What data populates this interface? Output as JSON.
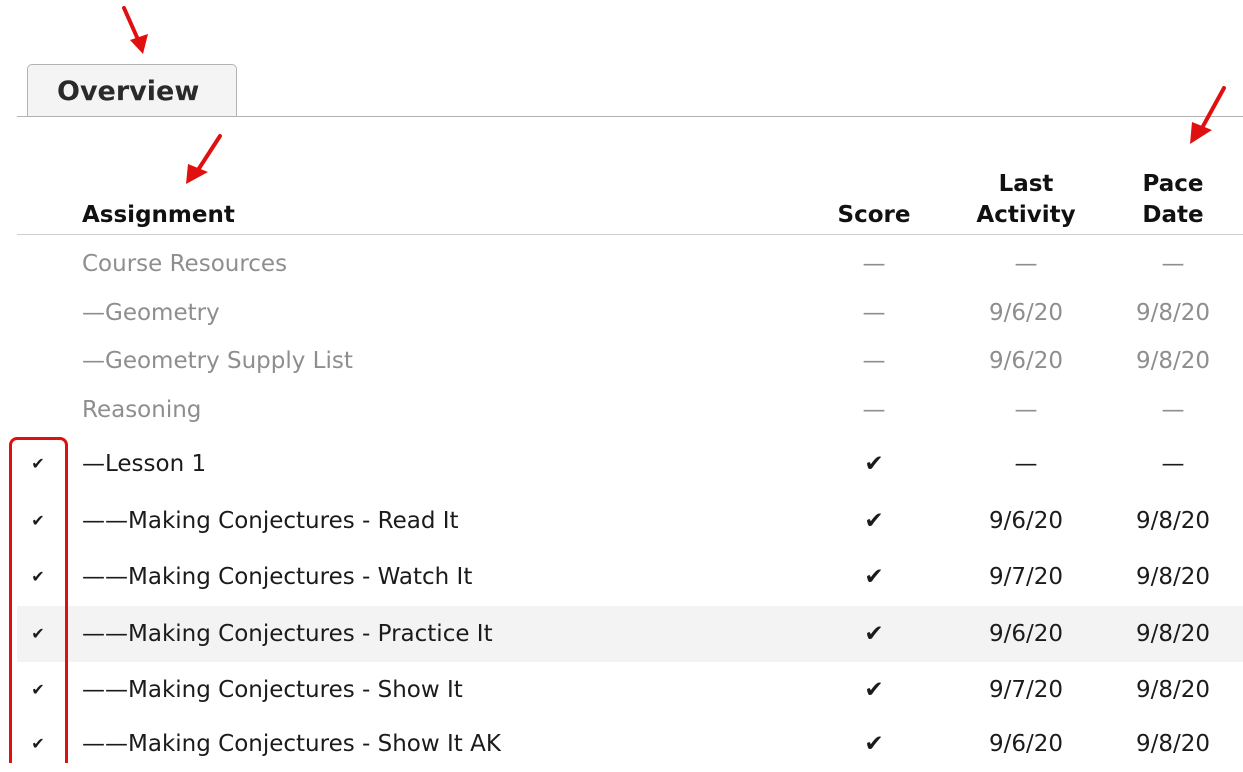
{
  "tab": {
    "label": "Overview"
  },
  "header": {
    "assignment": "Assignment",
    "score": "Score",
    "last_activity_line1": "Last",
    "last_activity_line2": "Activity",
    "pace_date_line1": "Pace",
    "pace_date_line2": "Date"
  },
  "rows": [
    {
      "name": "Course Resources",
      "score": "—",
      "last": "—",
      "pace": "—",
      "completed": false,
      "style": "muted"
    },
    {
      "name": "—Geometry",
      "score": "—",
      "last": "9/6/20",
      "pace": "9/8/20",
      "completed": false,
      "style": "muted"
    },
    {
      "name": "—Geometry Supply List",
      "score": "—",
      "last": "9/6/20",
      "pace": "9/8/20",
      "completed": false,
      "style": "muted"
    },
    {
      "name": "Reasoning",
      "score": "—",
      "last": "—",
      "pace": "—",
      "completed": false,
      "style": "muted"
    },
    {
      "name": "—Lesson 1",
      "score": "✔",
      "last": "—",
      "pace": "—",
      "completed": true,
      "style": "dark"
    },
    {
      "name": "——Making Conjectures - Read It",
      "score": "✔",
      "last": "9/6/20",
      "pace": "9/8/20",
      "completed": true,
      "style": "dark"
    },
    {
      "name": "——Making Conjectures - Watch It",
      "score": "✔",
      "last": "9/7/20",
      "pace": "9/8/20",
      "completed": true,
      "style": "dark"
    },
    {
      "name": "——Making Conjectures - Practice It",
      "score": "✔",
      "last": "9/6/20",
      "pace": "9/8/20",
      "completed": true,
      "style": "dark",
      "highlighted": true
    },
    {
      "name": "——Making Conjectures - Show It",
      "score": "✔",
      "last": "9/7/20",
      "pace": "9/8/20",
      "completed": true,
      "style": "dark"
    },
    {
      "name": "——Making Conjectures - Show It AK",
      "score": "✔",
      "last": "9/6/20",
      "pace": "9/8/20",
      "completed": true,
      "style": "dark"
    }
  ],
  "colors": {
    "annotation": "#e01010",
    "completed_check": "#3aa83a",
    "muted_text": "#8e8e8e"
  }
}
